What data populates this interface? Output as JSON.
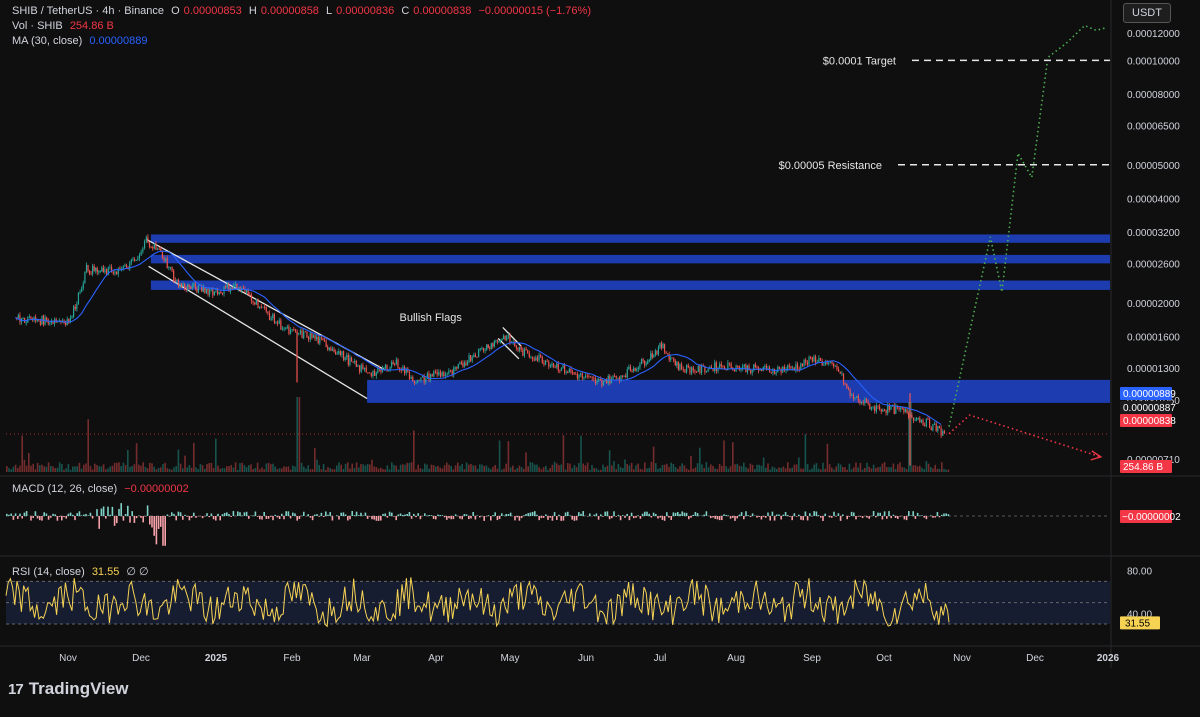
{
  "header": {
    "symbol": "SHIB / TetherUS · 4h · Binance",
    "open_label": "O",
    "open": "0.00000853",
    "high_label": "H",
    "high": "0.00000858",
    "low_label": "L",
    "low": "0.00000836",
    "close_label": "C",
    "close": "0.00000838",
    "change": "−0.00000015 (−1.76%)",
    "vol_label": "Vol · SHIB",
    "vol_value": "254.86 B",
    "ma_label": "MA (30, close)",
    "ma_value": "0.00000889",
    "currency": "USDT"
  },
  "macd_legend": {
    "label": "MACD (12, 26, close)",
    "value": "−0.00000002"
  },
  "rsi_legend": {
    "label": "RSI (14, close)",
    "value": "31.55",
    "extra": "∅ ∅"
  },
  "footer": {
    "brand": "TradingView"
  },
  "colors": {
    "background": "#0f0f10",
    "up": "#26a69a",
    "down": "#ef5350",
    "zone": "#1e3fb8",
    "ma": "#2962ff",
    "rsi": "#f7d354",
    "projection_up": "#4caf50",
    "projection_down": "#f23645"
  },
  "chart_data": {
    "type": "line",
    "title": "SHIB / TetherUS · 4h · Binance",
    "y_scale": "log",
    "y_ticks": [
      "0.00012000",
      "0.00010000",
      "0.00008000",
      "0.00006500",
      "0.00005000",
      "0.00004000",
      "0.00003200",
      "0.00002600",
      "0.00002000",
      "0.00001600",
      "0.00001300",
      "0.00001050",
      "0.00000710"
    ],
    "x_ticks": [
      "Nov",
      "Dec",
      "2025",
      "Feb",
      "Mar",
      "Apr",
      "May",
      "Jun",
      "Jul",
      "Aug",
      "Sep",
      "Oct",
      "Nov",
      "Dec",
      "2026"
    ],
    "price_series": {
      "name": "SHIB / TetherUS",
      "x": [
        "2024-10-12",
        "2024-10-25",
        "2024-11-05",
        "2024-11-12",
        "2024-11-20",
        "2024-11-28",
        "2024-12-05",
        "2024-12-08",
        "2024-12-15",
        "2024-12-22",
        "2024-12-30",
        "2025-01-08",
        "2025-01-15",
        "2025-01-22",
        "2025-02-01",
        "2025-02-08",
        "2025-02-18",
        "2025-03-01",
        "2025-03-10",
        "2025-03-18",
        "2025-03-26",
        "2025-04-05",
        "2025-04-12",
        "2025-04-20",
        "2025-04-28",
        "2025-05-05",
        "2025-05-13",
        "2025-05-20",
        "2025-06-01",
        "2025-06-12",
        "2025-06-22",
        "2025-07-01",
        "2025-07-12",
        "2025-07-20",
        "2025-07-28",
        "2025-08-05",
        "2025-08-15",
        "2025-08-25",
        "2025-09-05",
        "2025-09-15",
        "2025-09-25",
        "2025-10-05",
        "2025-10-10",
        "2025-10-20",
        "2025-11-01",
        "2025-11-10",
        "2025-11-20"
      ],
      "y": [
        1.8e-05,
        1.78e-05,
        1.78e-05,
        2.5e-05,
        2.45e-05,
        2.5e-05,
        2.7e-05,
        3.05e-05,
        2.75e-05,
        2.25e-05,
        2.2e-05,
        2.15e-05,
        2.25e-05,
        2.1e-05,
        1.8e-05,
        1.65e-05,
        1.6e-05,
        1.45e-05,
        1.3e-05,
        1.25e-05,
        1.35e-05,
        1.18e-05,
        1.25e-05,
        1.25e-05,
        1.4e-05,
        1.5e-05,
        1.6e-05,
        1.45e-05,
        1.35e-05,
        1.25e-05,
        1.18e-05,
        1.22e-05,
        1.35e-05,
        1.5e-05,
        1.3e-05,
        1.28e-05,
        1.32e-05,
        1.3e-05,
        1.28e-05,
        1.3e-05,
        1.38e-05,
        1.28e-05,
        1.08e-05,
        1e-05,
        9.8e-06,
        9.2e-06,
        8.4e-06
      ]
    },
    "moving_average": {
      "name": "MA (30, close)",
      "last": 8.89e-06
    },
    "last_price": 8.38e-06,
    "price_tags": [
      "0.00000889",
      "0.00000887",
      "0.00000838"
    ],
    "volume_tag": "254.86 B",
    "resistance_zones": [
      {
        "low": 2.98e-05,
        "high": 3.15e-05
      },
      {
        "low": 2.6e-05,
        "high": 2.75e-05
      },
      {
        "low": 2.18e-05,
        "high": 2.32e-05
      },
      {
        "low": 1.03e-05,
        "high": 1.2e-05
      }
    ],
    "levels": [
      {
        "label": "$0.0001 Target",
        "value": 0.0001
      },
      {
        "label": "$0.00005 Resistance",
        "value": 5e-05
      }
    ],
    "annotations": [
      {
        "text": "Bullish Flags",
        "x": "2025-05-01",
        "y": 1.75e-05
      }
    ],
    "projection_up": {
      "x": [
        "2025-11-22",
        "2025-12-10",
        "2025-12-15",
        "2025-12-22",
        "2025-12-28",
        "2026-01-04",
        "2026-01-12",
        "2026-01-20",
        "2026-01-25",
        "2026-01-29"
      ],
      "y": [
        8.8e-06,
        3.1e-05,
        2.15e-05,
        5.4e-05,
        4.6e-05,
        0.000102,
        0.000112,
        0.000126,
        0.000122,
        0.000124
      ]
    },
    "projection_down": {
      "x": [
        "2025-11-22",
        "2025-12-01",
        "2026-01-27"
      ],
      "y": [
        8.4e-06,
        9.5e-06,
        7.2e-06
      ]
    },
    "macd": {
      "name": "MACD (12, 26, close)",
      "last": -2e-08
    },
    "rsi": {
      "name": "RSI (14, close)",
      "last": 31.55,
      "levels": [
        70,
        50,
        30
      ],
      "tick_labels": [
        "80.00",
        "40.00"
      ]
    }
  }
}
